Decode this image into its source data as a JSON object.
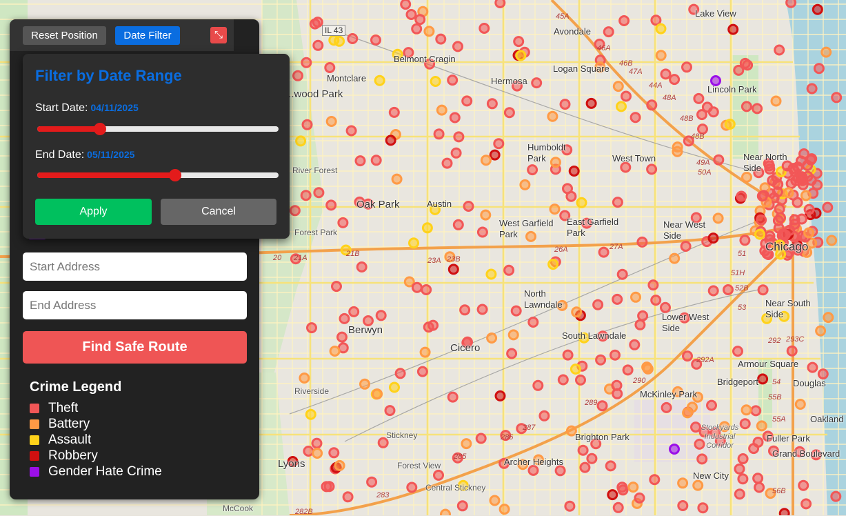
{
  "toolbar": {
    "reset_label": "Reset Position",
    "date_filter_label": "Date Filter",
    "expand_icon": "expand-icon"
  },
  "date_filter": {
    "title": "Filter by Date Range",
    "start_label": "Start Date:",
    "start_value": "04/11/2025",
    "start_fraction": 0.26,
    "end_label": "End Date:",
    "end_value": "05/11/2025",
    "end_fraction": 0.57,
    "apply_label": "Apply",
    "cancel_label": "Cancel"
  },
  "route": {
    "start_placeholder": "Start Address",
    "end_placeholder": "End Address",
    "find_label": "Find Safe Route"
  },
  "legend": {
    "title": "Crime Legend",
    "items": [
      {
        "label": "Theft",
        "color": "#f25757"
      },
      {
        "label": "Battery",
        "color": "#ff9a45"
      },
      {
        "label": "Assault",
        "color": "#ffd21a"
      },
      {
        "label": "Robbery",
        "color": "#d01010"
      },
      {
        "label": "Gender Hate Crime",
        "color": "#9b0fe8"
      }
    ]
  },
  "map": {
    "places": {
      "lake_view": "Lake View",
      "avondale": "Avondale",
      "belmont_cragin": "Belmont Cragin",
      "montclare": "Montclare",
      "hermosa": "Hermosa",
      "logan_square": "Logan Square",
      "lincoln_park": "Lincoln Park",
      "elmwood_park": "...wood Park",
      "humboldt_park": "Humboldt Park",
      "west_town": "West Town",
      "near_north_side": "Near North Side",
      "river_forest": "River Forest",
      "oak_park": "Oak Park",
      "austin": "Austin",
      "west_garfield_park": "West Garfield Park",
      "east_garfield_park": "East Garfield Park",
      "near_west_side": "Near West Side",
      "chicago": "Chicago",
      "forest_park": "Forest Park",
      "north_lawndale": "North Lawndale",
      "near_south_side": "Near South Side",
      "lower_west_side": "Lower West Side",
      "berwyn": "Berwyn",
      "cicero": "Cicero",
      "south_lawndale": "South Lawndale",
      "armour_square": "Armour Square",
      "bridgeport": "Bridgeport",
      "douglas": "Douglas",
      "riverside": "Riverside",
      "mckinley_park": "McKinley Park",
      "stickney": "Stickney",
      "brighton_park": "Brighton Park",
      "stockyards": "Stockyards Industrial Corridor",
      "fuller_park": "Fuller Park",
      "grand_boulevard": "Grand Boulevard",
      "oakland": "Oakland",
      "lyons": "Lyons",
      "forest_view": "Forest View",
      "archer_heights": "Archer Heights",
      "new_city": "New City",
      "central_stickney": "Central Stickney",
      "mccook": "McCook"
    },
    "highways": {
      "il43": "IL 43",
      "h45a": "45A",
      "h46a": "46A",
      "h46b": "46B",
      "h47a": "47A",
      "h44a": "44A",
      "h48a": "48A",
      "h48b": "48B",
      "h49a": "49A",
      "h50a": "50A",
      "h20": "20",
      "h21a": "21A",
      "h21b": "21B",
      "h23a": "23A",
      "h23b": "23B",
      "h26a": "26A",
      "h27a": "27A",
      "h51": "51",
      "h51h": "51H",
      "h52b": "52B",
      "h53": "53",
      "h292": "292",
      "h293c": "293C",
      "h292a": "292A",
      "h290": "290",
      "h289": "289",
      "h287": "287",
      "h286": "286",
      "h285": "285",
      "h283": "283",
      "h282b": "282B",
      "h54": "54",
      "h55b": "55B",
      "h55a": "55A",
      "h56b": "56B"
    }
  }
}
